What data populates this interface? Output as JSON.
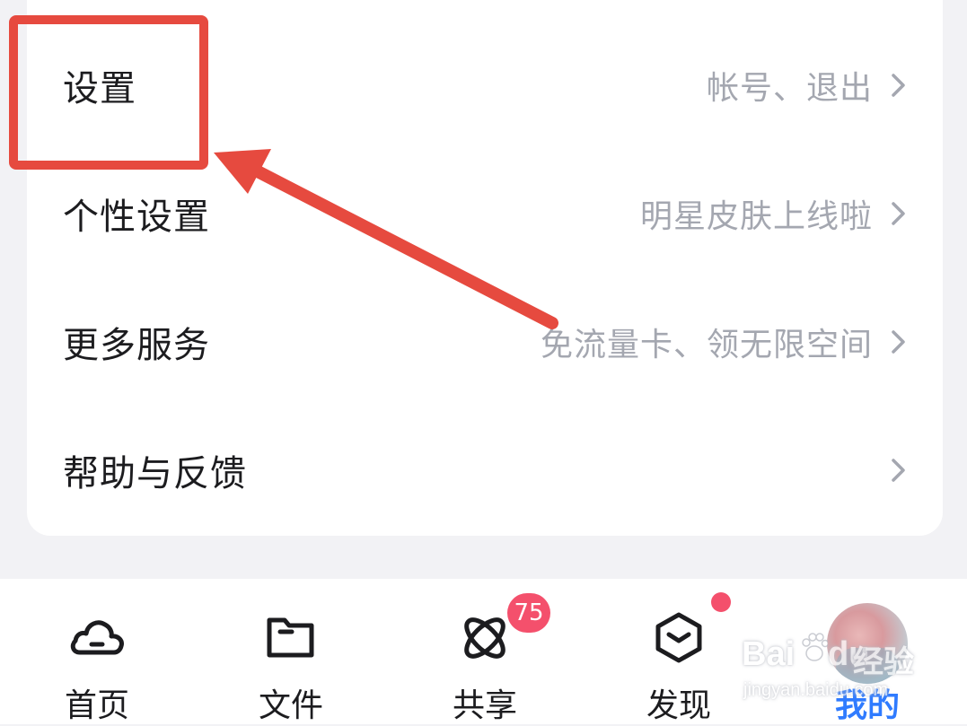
{
  "menu": {
    "items": [
      {
        "title": "设置",
        "hint": "帐号、退出"
      },
      {
        "title": "个性设置",
        "hint": "明星皮肤上线啦"
      },
      {
        "title": "更多服务",
        "hint": "免流量卡、领无限空间"
      },
      {
        "title": "帮助与反馈",
        "hint": ""
      }
    ]
  },
  "tabbar": {
    "tabs": [
      {
        "label": "首页",
        "icon": "cloud-icon"
      },
      {
        "label": "文件",
        "icon": "folder-icon"
      },
      {
        "label": "共享",
        "icon": "atom-icon",
        "badge": "75"
      },
      {
        "label": "发现",
        "icon": "box-icon",
        "dot": true
      },
      {
        "label": "我的",
        "icon": "avatar",
        "active": true
      }
    ]
  },
  "colors": {
    "accent": "#2f7bff",
    "badge": "#f4506c",
    "annotation": "#e64a3f"
  },
  "watermark": {
    "brand": "Bai",
    "brand_tail": "du",
    "cn": "经验",
    "url": "jingyan.baidu.com"
  }
}
